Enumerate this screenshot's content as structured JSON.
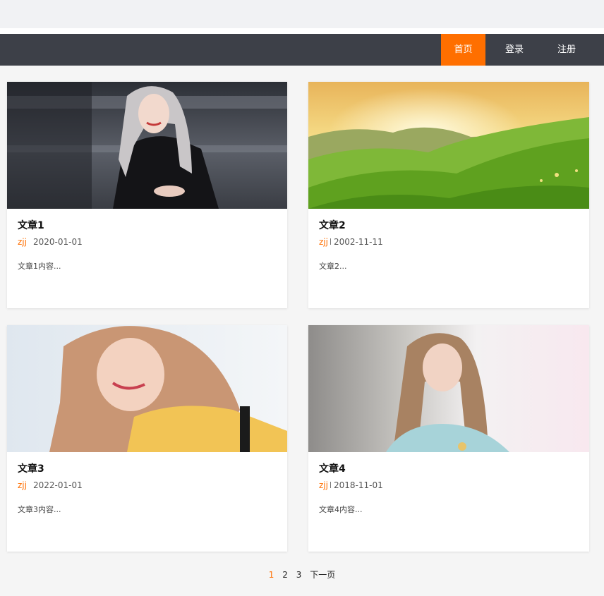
{
  "nav": {
    "home": "首页",
    "login": "登录",
    "register": "注册"
  },
  "colors": {
    "accent": "#ff6f00",
    "navbar": "#3d4048",
    "background": "#f5f5f5"
  },
  "articles": [
    {
      "title": "文章1",
      "author": "zjj",
      "date": "2020-01-01",
      "excerpt": "文章1内容..."
    },
    {
      "title": "文章2",
      "author": "zjj",
      "date": "2002-11-11",
      "excerpt": "文章2..."
    },
    {
      "title": "文章3",
      "author": "zjj",
      "date": "2022-01-01",
      "excerpt": "文章3内容..."
    },
    {
      "title": "文章4",
      "author": "zjj",
      "date": "2018-11-01",
      "excerpt": "文章4内容..."
    }
  ],
  "pagination": {
    "current": "1",
    "page2": "2",
    "page3": "3",
    "next": "下一页"
  }
}
